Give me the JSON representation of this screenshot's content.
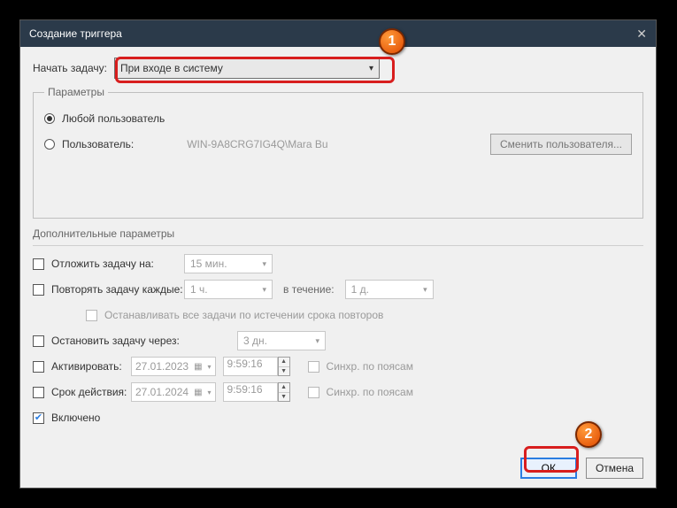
{
  "title": "Создание триггера",
  "begin_task_label": "Начать задачу:",
  "begin_task_value": "При входе в систему",
  "params_legend": "Параметры",
  "radio_any_user": "Любой пользователь",
  "radio_user": "Пользователь:",
  "user_value": "WIN-9A8CRG7IG4Q\\Mara Bu",
  "change_user_btn": "Сменить пользователя...",
  "advanced_label": "Дополнительные параметры",
  "delay_label": "Отложить задачу на:",
  "delay_value": "15 мин.",
  "repeat_label": "Повторять задачу каждые:",
  "repeat_value": "1 ч.",
  "during_label": "в течение:",
  "during_value": "1 д.",
  "stop_all_label": "Останавливать все задачи по истечении срока повторов",
  "stop_after_label": "Остановить задачу через:",
  "stop_after_value": "3 дн.",
  "activate_label": "Активировать:",
  "activate_date": "27.01.2023",
  "activate_time": "9:59:16",
  "expire_label": "Срок действия:",
  "expire_date": "27.01.2024",
  "expire_time": "9:59:16",
  "sync_tz_label": "Синхр. по поясам",
  "enabled_label": "Включено",
  "ok_label": "ОК",
  "cancel_label": "Отмена",
  "markers": {
    "one": "1",
    "two": "2"
  }
}
